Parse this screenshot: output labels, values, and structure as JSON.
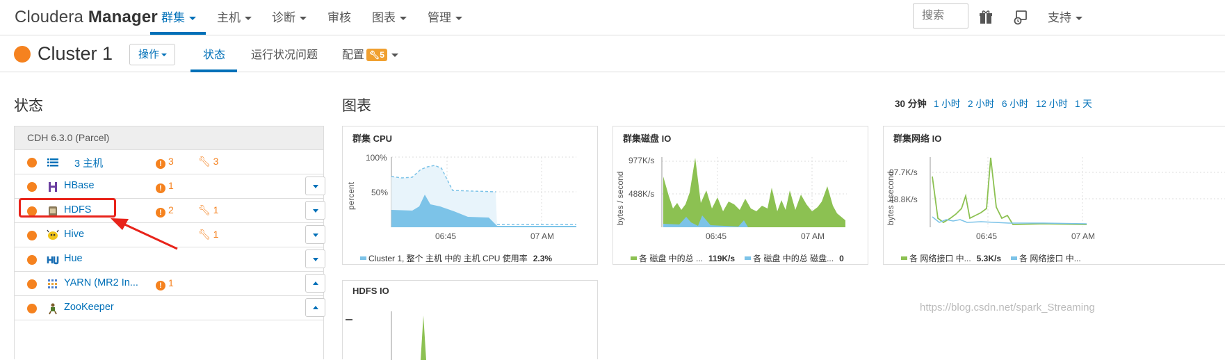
{
  "brand": {
    "prefix": "Cloudera ",
    "bold": "Manager"
  },
  "nav": {
    "items": [
      {
        "label": "群集",
        "active": true
      },
      {
        "label": "主机"
      },
      {
        "label": "诊断"
      },
      {
        "label": "审核"
      },
      {
        "label": "图表"
      },
      {
        "label": "管理"
      }
    ],
    "search_placeholder": "搜索",
    "support_label": "支持"
  },
  "cluster": {
    "title": "Cluster 1",
    "ops_label": "操作",
    "tabs": [
      {
        "label": "状态",
        "active": true
      },
      {
        "label": "运行状况问题"
      },
      {
        "label": "配置",
        "badge": "5"
      }
    ]
  },
  "status": {
    "heading": "状态",
    "table_header": "CDH 6.3.0 (Parcel)",
    "rows": [
      {
        "name": "3 主机",
        "icon": "hosts-list-icon",
        "alerts": "3",
        "configs": "3",
        "button": "none"
      },
      {
        "name": "HBase",
        "icon": "hbase-icon",
        "alerts": "1",
        "configs": "",
        "button": "down"
      },
      {
        "name": "HDFS",
        "icon": "hdfs-icon",
        "alerts": "2",
        "configs": "1",
        "button": "down"
      },
      {
        "name": "Hive",
        "icon": "hive-icon",
        "alerts": "",
        "configs": "1",
        "button": "down"
      },
      {
        "name": "Hue",
        "icon": "hue-icon",
        "alerts": "",
        "configs": "",
        "button": "down"
      },
      {
        "name": "YARN (MR2 In...",
        "icon": "yarn-icon",
        "alerts": "1",
        "configs": "",
        "button": "up"
      },
      {
        "name": "ZooKeeper",
        "icon": "zookeeper-icon",
        "alerts": "",
        "configs": "",
        "button": "up"
      }
    ]
  },
  "charts": {
    "heading": "图表",
    "ranges": [
      "30 分钟",
      "1 小时",
      "2 小时",
      "6 小时",
      "12 小时",
      "1 天"
    ],
    "current_range": "30 分钟",
    "cpu": {
      "title": "群集 CPU",
      "ylabel": "percent",
      "yticks": [
        "100%",
        "50%"
      ],
      "xticks": [
        "06:45",
        "07 AM"
      ],
      "legend": "Cluster 1, 整个 主机 中的 主机 CPU 使用率",
      "legend_value": "2.3%"
    },
    "disk": {
      "title": "群集磁盘 IO",
      "ylabel": "bytes / second",
      "yticks": [
        "977K/s",
        "488K/s"
      ],
      "xticks": [
        "06:45",
        "07 AM"
      ],
      "legend1": "各 磁盘 中的总 ...",
      "legend1_value": "119K/s",
      "legend2": "各 磁盘 中的总 磁盘...",
      "legend2_value": "0"
    },
    "network": {
      "title": "群集网络 IO",
      "ylabel": "bytes / second",
      "yticks": [
        "97.7K/s",
        "48.8K/s"
      ],
      "xticks": [
        "06:45",
        "07 AM"
      ],
      "legend1": "各 网络接口 中...",
      "legend1_value": "5.3K/s",
      "legend2": "各 网络接口 中..."
    },
    "hdfs": {
      "title": "HDFS IO"
    }
  },
  "colors": {
    "accent": "#0070b8",
    "warning": "#f5821f",
    "cpu_fill": "#7cc3e8",
    "disk_fill": "#8cc152",
    "annotation": "#e8231a"
  },
  "watermark": "https://blog.csdn.net/spark_Streaming"
}
